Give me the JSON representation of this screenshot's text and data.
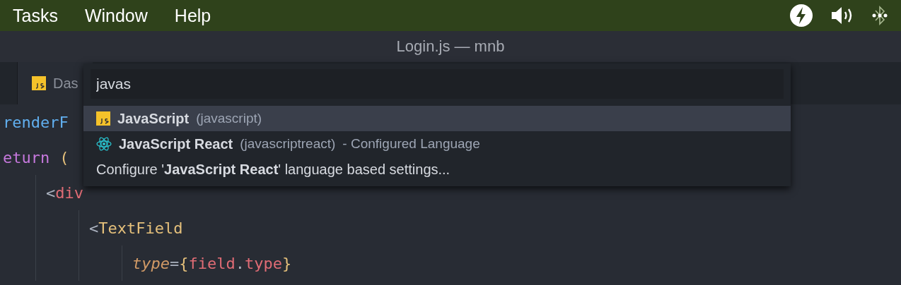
{
  "menu_bar": {
    "items": [
      {
        "label": "Tasks"
      },
      {
        "label": "Window"
      },
      {
        "label": "Help"
      }
    ]
  },
  "window": {
    "title": "Login.js — mnb"
  },
  "tabs": [
    {
      "label": "Das"
    }
  ],
  "editor": {
    "lines": [
      {
        "tokens": [
          {
            "kind": "func",
            "text": "renderF"
          }
        ]
      },
      {
        "tokens": [
          {
            "kind": "keyword",
            "text": "eturn"
          },
          {
            "kind": "paren",
            "text": "("
          }
        ],
        "children": [
          {
            "tokens": [
              {
                "kind": "punct",
                "text": "<"
              },
              {
                "kind": "tag",
                "text": "div"
              }
            ],
            "children": [
              {
                "tokens": [
                  {
                    "kind": "punct",
                    "text": "<"
                  },
                  {
                    "kind": "component",
                    "text": "TextField"
                  }
                ],
                "children": [
                  {
                    "tokens": [
                      {
                        "kind": "attr",
                        "text": "type"
                      },
                      {
                        "kind": "punct",
                        "text": "="
                      },
                      {
                        "kind": "paren",
                        "text": "{"
                      },
                      {
                        "kind": "var",
                        "text": "field"
                      },
                      {
                        "kind": "punct",
                        "text": "."
                      },
                      {
                        "kind": "var",
                        "text": "type"
                      },
                      {
                        "kind": "paren",
                        "text": "}"
                      }
                    ]
                  }
                ]
              }
            ]
          }
        ]
      }
    ]
  },
  "quick_pick": {
    "value": "javas",
    "items": [
      {
        "kind": "language",
        "name": "JavaScript",
        "id": "(javascript)",
        "selected": true
      },
      {
        "kind": "language",
        "name": "JavaScript React",
        "id": "(javascriptreact)",
        "note": "- Configured Language",
        "selected": false
      },
      {
        "kind": "action",
        "text": "Configure '**JavaScript React**' language based settings...",
        "selected": false
      }
    ]
  }
}
